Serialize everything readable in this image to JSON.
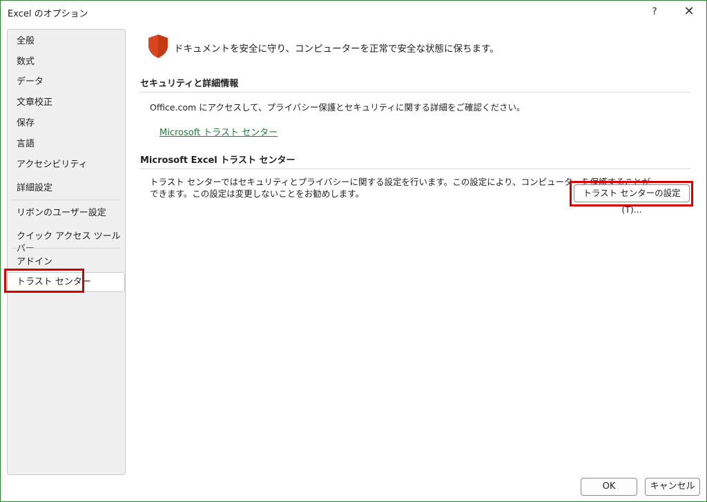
{
  "window": {
    "title": "Excel のオプション",
    "help_label": "?",
    "close_label": "✕"
  },
  "sidebar": {
    "items": [
      {
        "label": "全般"
      },
      {
        "label": "数式"
      },
      {
        "label": "データ"
      },
      {
        "label": "文章校正"
      },
      {
        "label": "保存"
      },
      {
        "label": "言語"
      },
      {
        "label": "アクセシビリティ"
      },
      {
        "label": "詳細設定"
      },
      {
        "label": "リボンのユーザー設定"
      },
      {
        "label": "クイック アクセス ツール バー"
      },
      {
        "label": "アドイン"
      },
      {
        "label": "トラスト センター"
      }
    ],
    "selected": "トラスト センター"
  },
  "main": {
    "headline": "ドキュメントを安全に守り、コンピューターを正常で安全な状態に保ちます。",
    "security_section": {
      "title": "セキュリティと詳細情報",
      "text": "Office.com にアクセスして、プライバシー保護とセキュリティに関する詳細をご確認ください。",
      "link": "Microsoft トラスト センター"
    },
    "trust_section": {
      "title": "Microsoft Excel トラスト センター",
      "text_line1": "トラスト センターではセキュリティとプライバシーに関する設定を行います。この設定により、コンピューターを保護することが",
      "text_line2": "できます。この設定は変更しないことをお勧めします。",
      "button_label": "トラスト センターの設定(T)..."
    }
  },
  "footer": {
    "ok_label": "OK",
    "cancel_label": "キャンセル"
  },
  "colors": {
    "highlight": "#d40000",
    "link": "#1e7a3a",
    "shield": "#d9461e",
    "window_border": "#2e7d32"
  }
}
